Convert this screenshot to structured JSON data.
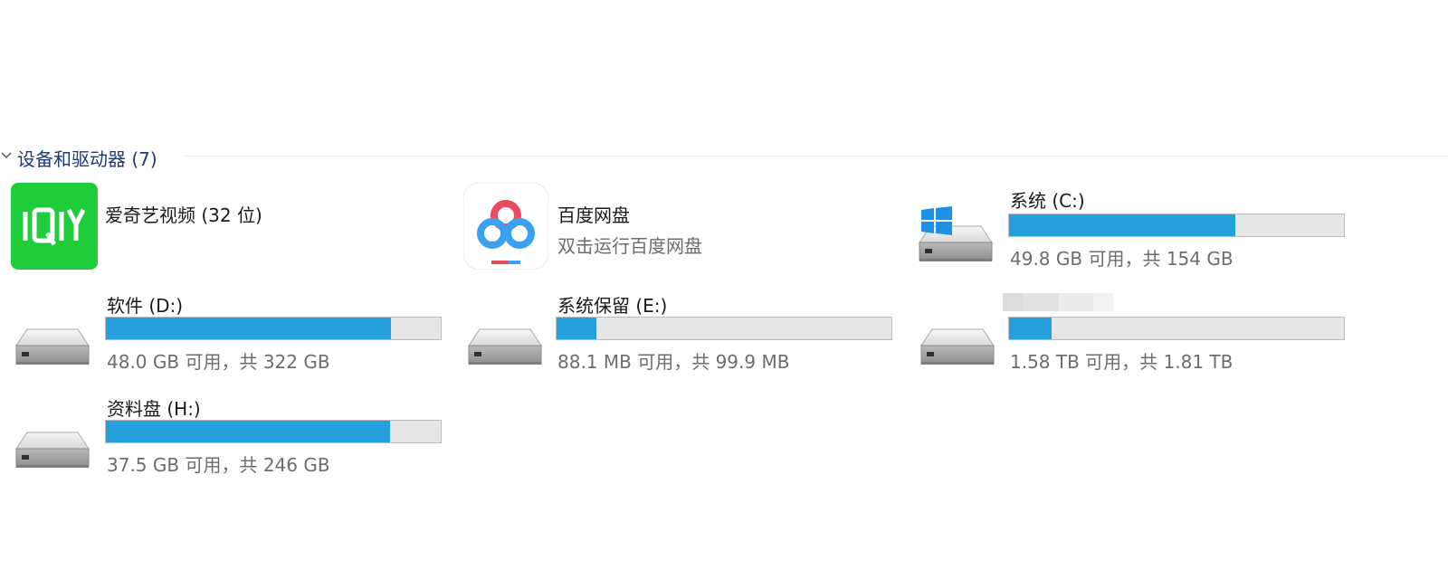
{
  "section": {
    "title": "设备和驱动器 (7)"
  },
  "apps": [
    {
      "name": "爱奇艺视频 (32 位)",
      "icon": "iqiyi-logo-icon",
      "logo_text": "iQIYI",
      "color": "#1fcc3a"
    },
    {
      "name": "百度网盘",
      "subtitle": "双击运行百度网盘",
      "icon": "baidu-netdisk-logo-icon"
    }
  ],
  "drives": [
    {
      "name": "系统 (C:)",
      "free_text": "49.8 GB 可用，共 154 GB",
      "used_fraction": 0.677,
      "os_badge": "windows-logo-icon"
    },
    {
      "name": "软件 (D:)",
      "free_text": "48.0 GB 可用，共 322 GB",
      "used_fraction": 0.851
    },
    {
      "name": "系统保留 (E:)",
      "free_text": "88.1 MB 可用，共 99.9 MB",
      "used_fraction": 0.118
    },
    {
      "name": "",
      "free_text": "1.58 TB 可用，共 1.81 TB",
      "used_fraction": 0.127,
      "name_obscured": true
    },
    {
      "name": "资料盘 (H:)",
      "free_text": "37.5 GB 可用，共 246 GB",
      "used_fraction": 0.848
    }
  ],
  "colors": {
    "usage_bar_fill": "#26a0da",
    "usage_bar_track": "#e6e6e6",
    "section_title": "#1e3a78",
    "iqiyi_green": "#1fcc3a"
  }
}
